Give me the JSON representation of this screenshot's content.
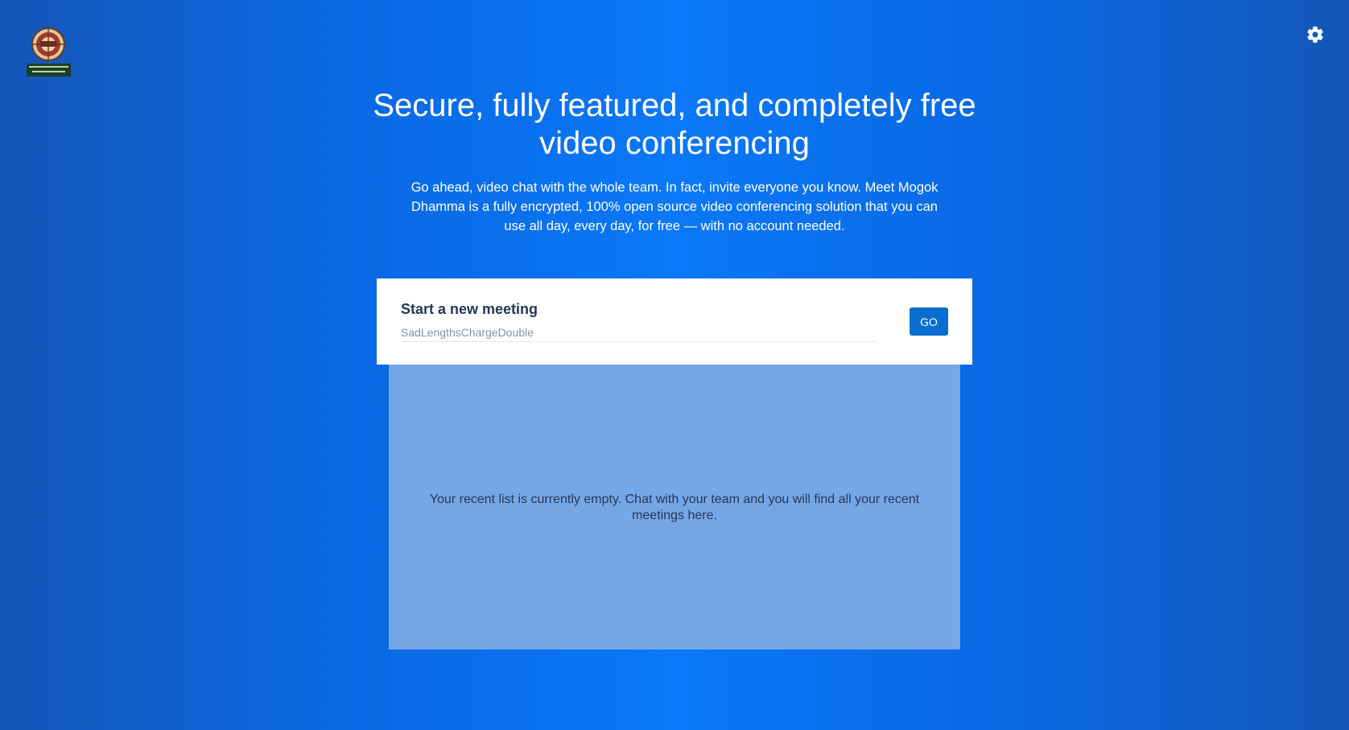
{
  "header": {
    "logo_name": "mogok-dhamma-logo",
    "settings_icon": "gear-icon"
  },
  "welcome": {
    "title": "Secure, fully featured, and completely free video conferencing",
    "description": "Go ahead, video chat with the whole team. In fact, invite everyone you know. Meet Mogok Dhamma is a fully encrypted, 100% open source video conferencing solution that you can use all day, every day, for free — with no account needed."
  },
  "new_meeting": {
    "title": "Start a new meeting",
    "placeholder": "SadLengthsChargeDouble",
    "go_label": "GO"
  },
  "recent": {
    "empty_message": "Your recent list is currently empty. Chat with your team and you will find all your recent meetings here."
  },
  "colors": {
    "brand": "#0a6ed1",
    "background": "#0a78f8",
    "recent_panel": "#75a6e6",
    "text_dark": "#253858"
  }
}
